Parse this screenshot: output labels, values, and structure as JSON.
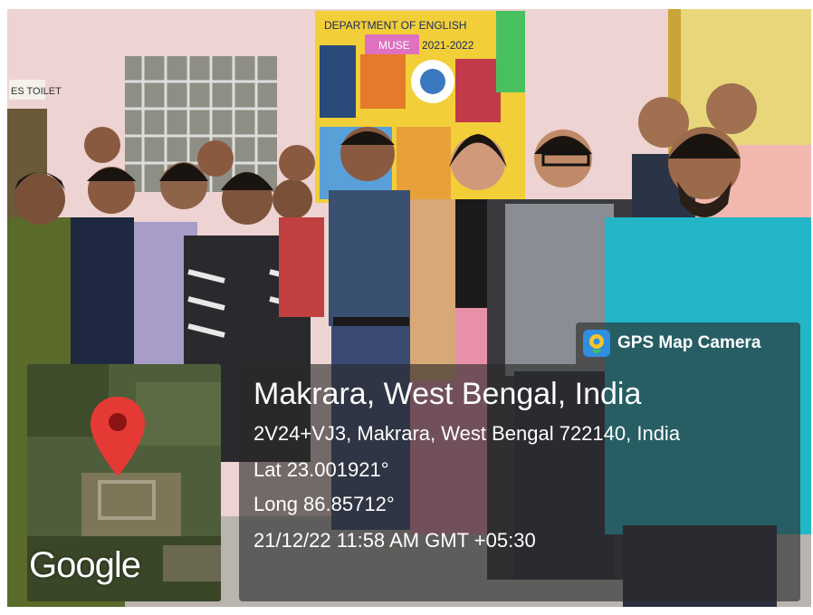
{
  "photo": {
    "poster_title": "DEPARTMENT OF ENGLISH",
    "poster_sub": "MUSE",
    "poster_year": "2021-2022",
    "door_sign": "ES TOILET"
  },
  "gps_badge": {
    "label": "GPS Map Camera",
    "icon": "map-pin-icon"
  },
  "map": {
    "brand": "Google",
    "pin_color": "#e53935"
  },
  "location": {
    "title": "Makrara, West Bengal, India",
    "address": "2V24+VJ3, Makrara, West Bengal 722140, India",
    "lat": "Lat 23.001921°",
    "long": "Long 86.85712°",
    "datetime": "21/12/22 11:58 AM GMT +05:30"
  },
  "colors": {
    "overlay": "#282828",
    "text": "#ffffff",
    "wall": "#f0d8d6"
  }
}
